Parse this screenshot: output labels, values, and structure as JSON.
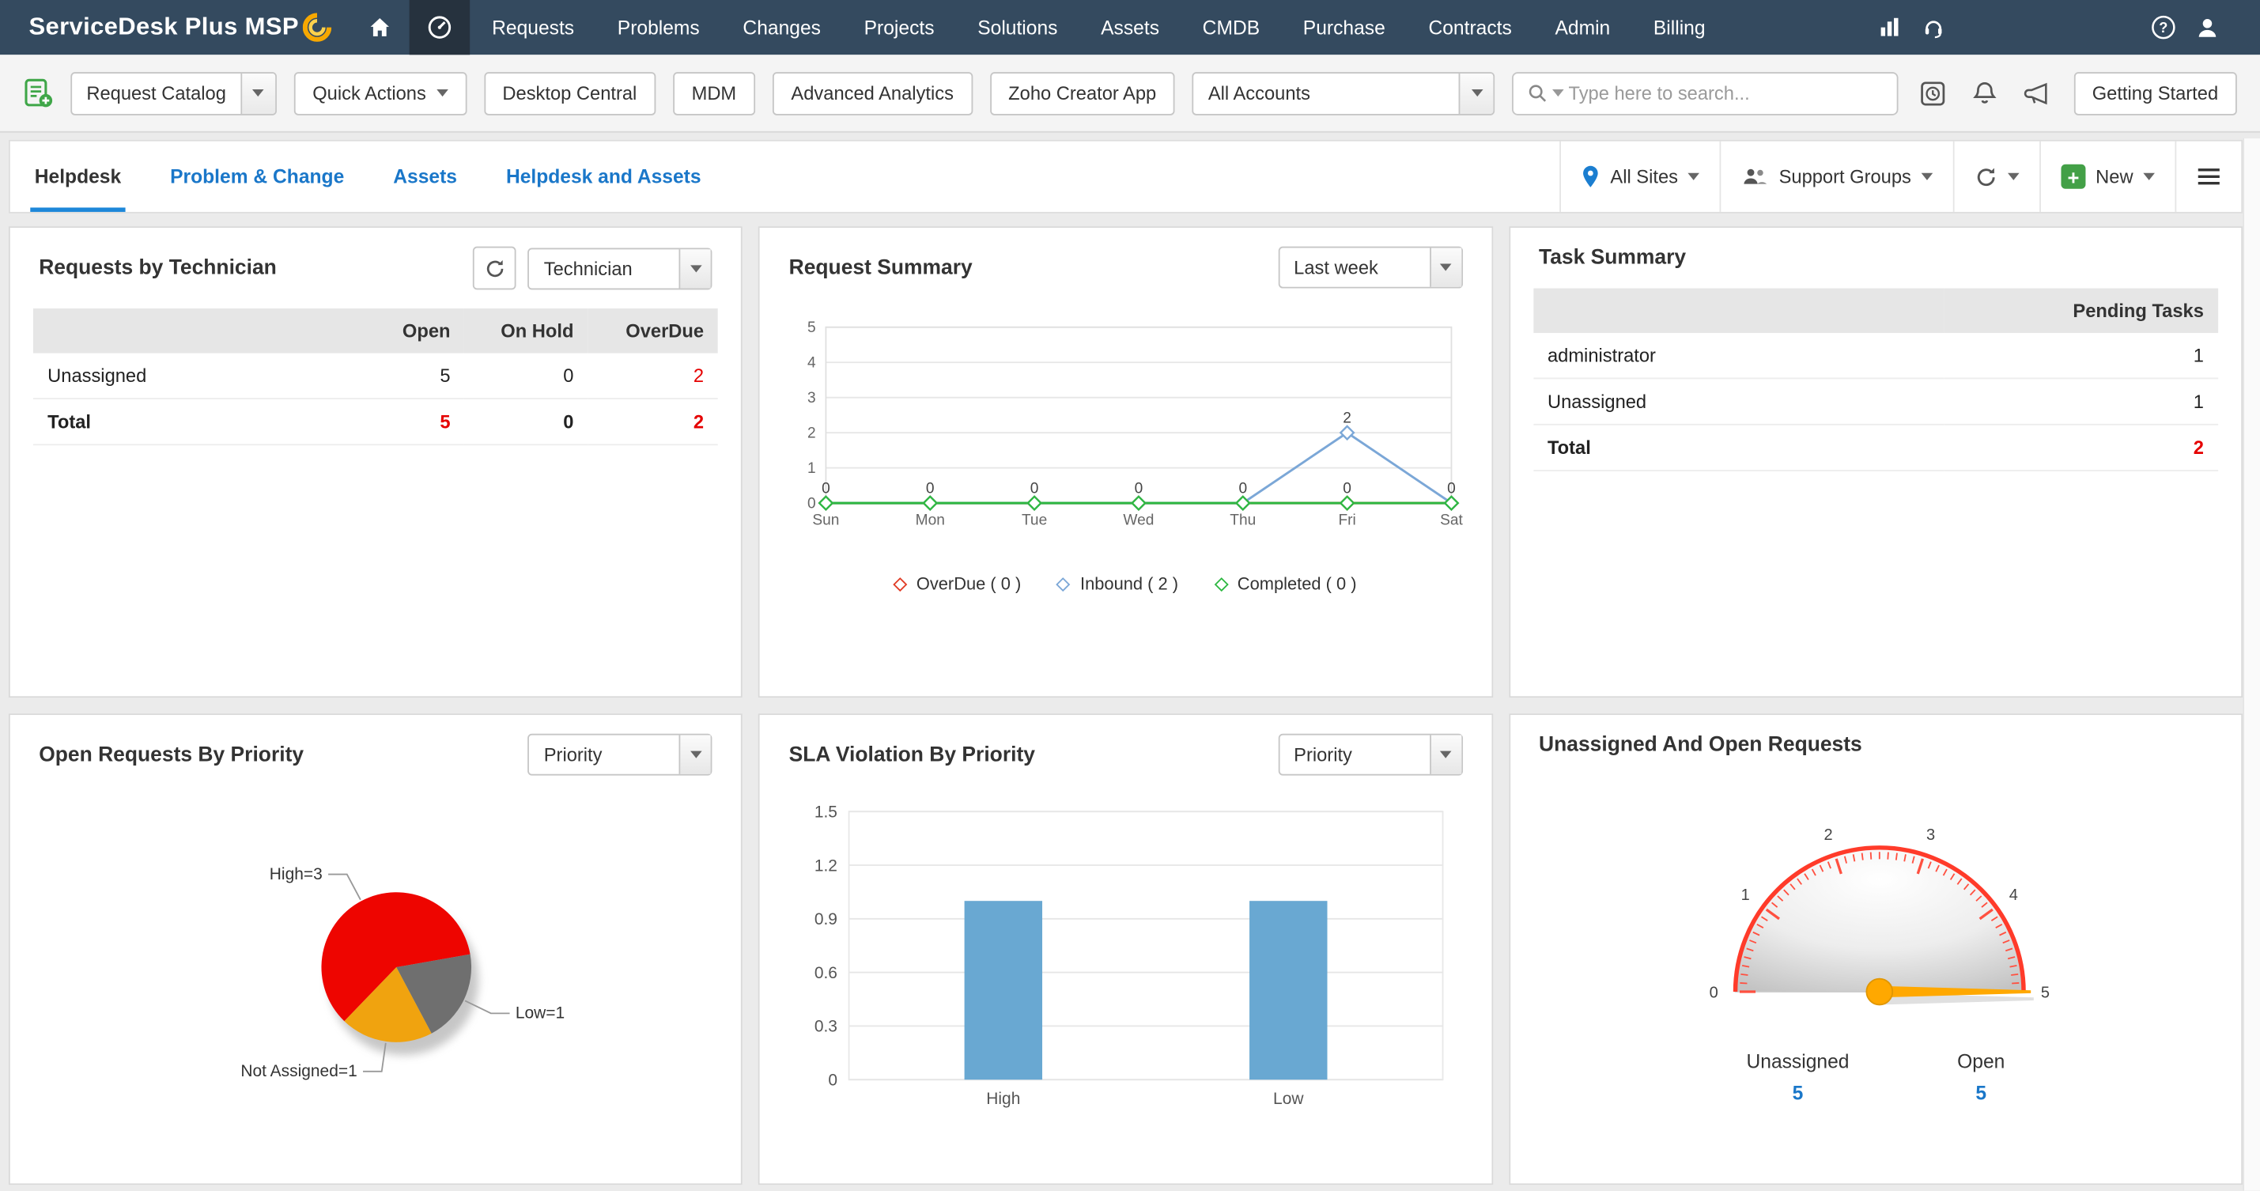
{
  "topnav": {
    "logo": "ServiceDesk Plus MSP",
    "items": [
      "Requests",
      "Problems",
      "Changes",
      "Projects",
      "Solutions",
      "Assets",
      "CMDB",
      "Purchase",
      "Contracts",
      "Admin",
      "Billing"
    ]
  },
  "toolbar": {
    "request_catalog": "Request Catalog",
    "quick_actions": "Quick Actions",
    "buttons": [
      "Desktop Central",
      "MDM",
      "Advanced Analytics",
      "Zoho Creator App"
    ],
    "accounts": "All Accounts",
    "search_placeholder": "Type here to search...",
    "getting_started": "Getting Started"
  },
  "tabbar": {
    "tabs": [
      "Helpdesk",
      "Problem & Change",
      "Assets",
      "Helpdesk and Assets"
    ],
    "active_tab": "Helpdesk",
    "all_sites": "All Sites",
    "support_groups": "Support Groups",
    "new": "New"
  },
  "card_controls": {
    "requests_by_technician": "Technician",
    "request_summary": "Last week",
    "open_requests_by_priority": "Priority",
    "sla_violation": "Priority"
  },
  "colors": {
    "accent_blue": "#1a77c9",
    "alert_red": "#e50000",
    "bar_blue": "#69a8d2",
    "pie_red": "#ee0500",
    "pie_gray": "#6f6f6f",
    "pie_orange": "#f0a30f",
    "gauge_needle_orange": "#ffa800",
    "new_button_green": "#43a047"
  },
  "chart_data": [
    {
      "id": "requests_by_technician",
      "type": "table",
      "title": "Requests by Technician",
      "columns": [
        "",
        "Open",
        "On Hold",
        "OverDue"
      ],
      "rows": [
        {
          "cells": [
            "Unassigned",
            "5",
            "0",
            "2"
          ]
        },
        {
          "cells": [
            "Total",
            "5",
            "0",
            "2"
          ]
        }
      ]
    },
    {
      "id": "request_summary",
      "type": "line",
      "title": "Request Summary",
      "x": [
        "Sun",
        "Mon",
        "Tue",
        "Wed",
        "Thu",
        "Fri",
        "Sat"
      ],
      "ylim": [
        0,
        5
      ],
      "yticks": [
        0,
        1,
        2,
        3,
        4,
        5
      ],
      "series": [
        {
          "name": "OverDue ( 0 )",
          "color": "#e03b24",
          "values": [
            0,
            0,
            0,
            0,
            0,
            0,
            0
          ]
        },
        {
          "name": "Inbound ( 2 )",
          "color": "#7ba7d7",
          "values": [
            0,
            0,
            0,
            0,
            0,
            2,
            0
          ]
        },
        {
          "name": "Completed ( 0 )",
          "color": "#2eb842",
          "values": [
            0,
            0,
            0,
            0,
            0,
            0,
            0
          ]
        }
      ],
      "legend_position": "bottom",
      "grid": true
    },
    {
      "id": "task_summary",
      "type": "table",
      "title": "Task Summary",
      "columns": [
        "",
        "Pending Tasks"
      ],
      "rows": [
        {
          "cells": [
            "administrator",
            "1"
          ]
        },
        {
          "cells": [
            "Unassigned",
            "1"
          ]
        },
        {
          "cells": [
            "Total",
            "2"
          ]
        }
      ]
    },
    {
      "id": "open_requests_by_priority",
      "type": "pie",
      "title": "Open Requests By Priority",
      "start_angle_deg": 224,
      "slices": [
        {
          "label": "High=3",
          "value": 3,
          "color": "#ee0500"
        },
        {
          "label": "Low=1",
          "value": 1,
          "color": "#6f6f6f"
        },
        {
          "label": "Not Assigned=1",
          "value": 1,
          "color": "#f0a30f"
        }
      ]
    },
    {
      "id": "sla_violation",
      "type": "bar",
      "title": "SLA Violation By Priority",
      "categories": [
        "High",
        "Low"
      ],
      "values": [
        1,
        1
      ],
      "ylim": [
        0,
        1.5
      ],
      "yticks": [
        0,
        0.3,
        0.6,
        0.9,
        1.2,
        1.5
      ],
      "bar_color": "#69a8d2",
      "grid": true
    },
    {
      "id": "unassigned_open",
      "type": "gauge",
      "title": "Unassigned And Open Requests",
      "min": 0,
      "max": 5,
      "value": 5,
      "major_ticks": [
        0,
        1,
        2,
        3,
        4,
        5
      ],
      "stats": [
        {
          "label": "Unassigned",
          "value": "5"
        },
        {
          "label": "Open",
          "value": "5"
        }
      ]
    }
  ]
}
